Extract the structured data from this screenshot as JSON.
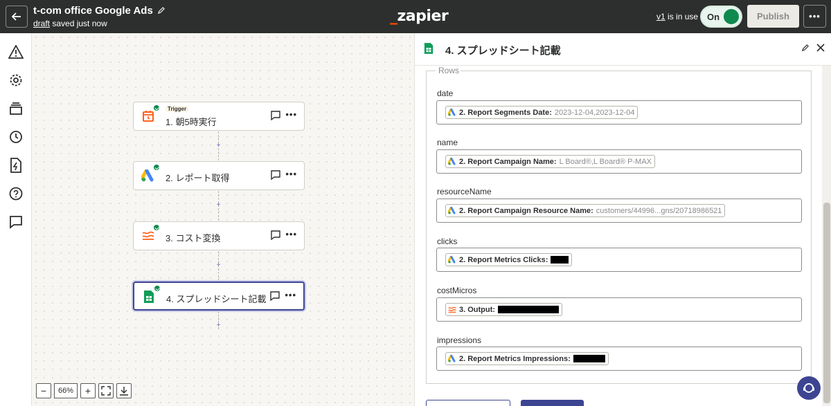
{
  "topbar": {
    "zap_title": "t-com office Google Ads",
    "draft_link": "draft",
    "draft_status": "saved just now",
    "logo": "zapier",
    "version_link": "v1",
    "version_status": "is in use",
    "toggle_label": "On",
    "publish_label": "Publish",
    "more_label": "•••"
  },
  "sidebar": {
    "items": [
      "warning-icon",
      "gear-icon",
      "versions-icon",
      "history-icon",
      "zap-runs-icon",
      "help-icon",
      "comment-icon"
    ]
  },
  "canvas": {
    "steps": [
      {
        "tag": "Trigger",
        "name": "1. 朝5時実行",
        "icon": "schedule-icon"
      },
      {
        "name": "2. レポート取得",
        "icon": "google-ads-icon"
      },
      {
        "name": "3. コスト変換",
        "icon": "formatter-icon"
      },
      {
        "name": "4. スプレッドシート記載",
        "icon": "google-sheets-icon"
      }
    ],
    "plus": "+",
    "zoom": {
      "minus": "−",
      "value": "66%",
      "plus": "+"
    }
  },
  "panel": {
    "title": "4. スプレッドシート記載",
    "rows_legend": "Rows",
    "fields": [
      {
        "label": "date",
        "pill_name": "2. Report Segments Date:",
        "pill_value": "2023-12-04,2023-12-04",
        "pill_icon": "google-ads-icon"
      },
      {
        "label": "name",
        "pill_name": "2. Report Campaign Name:",
        "pill_value": "L Board®,L Board® P-MAX",
        "pill_icon": "google-ads-icon"
      },
      {
        "label": "resourceName",
        "pill_name": "2. Report Campaign Resource Name:",
        "pill_value": "customers/44996...gns/20718986521",
        "pill_icon": "google-ads-icon"
      },
      {
        "label": "clicks",
        "pill_name": "2. Report Metrics Clicks:",
        "pill_value": "",
        "pill_icon": "google-ads-icon"
      },
      {
        "label": "costMicros",
        "pill_name": "3. Output:",
        "pill_value": "",
        "pill_icon": "formatter-icon"
      },
      {
        "label": "impressions",
        "pill_name": "2. Report Metrics Impressions:",
        "pill_value": "",
        "pill_icon": "google-ads-icon"
      }
    ]
  },
  "colors": {
    "topbar": "#2d2e2e",
    "accent": "#3d4592",
    "success": "#0f8a4f",
    "zapier_orange": "#ff4f00"
  }
}
